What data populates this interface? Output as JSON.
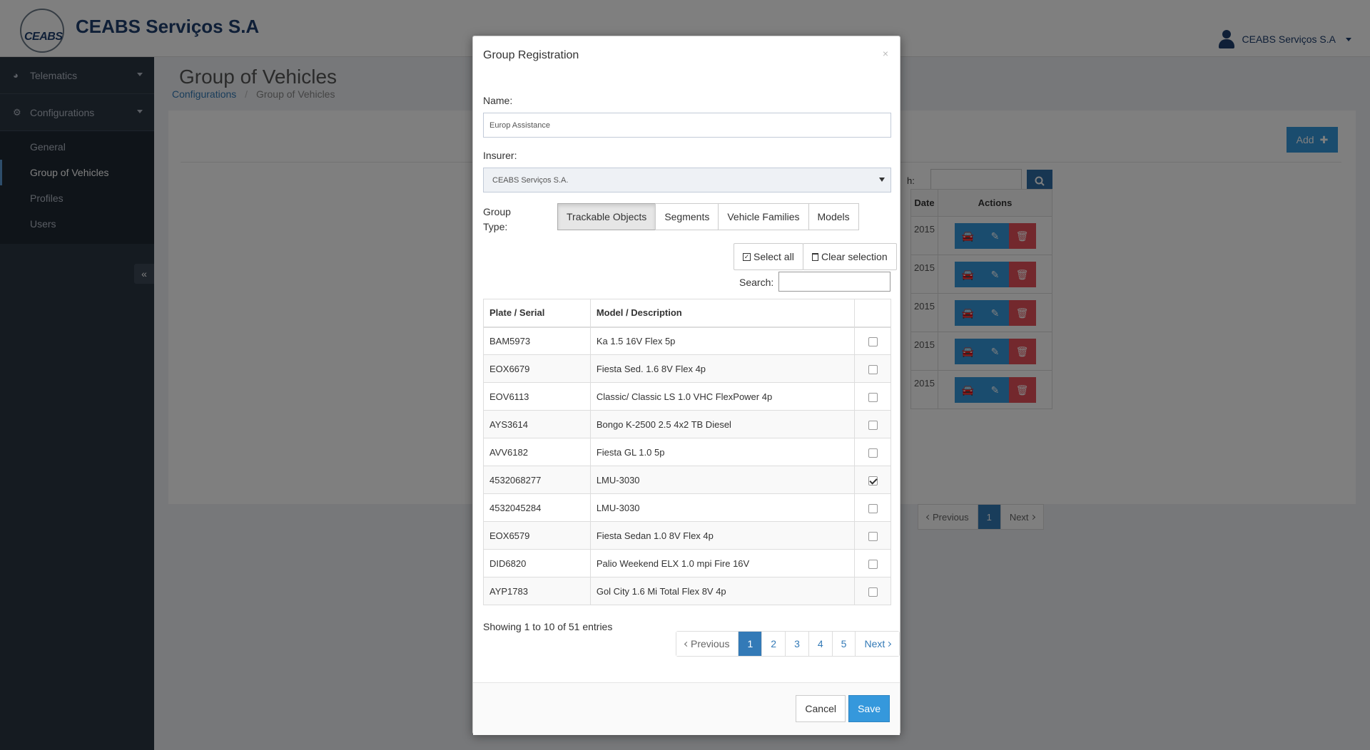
{
  "app": {
    "brand": "CEABS Serviços S.A",
    "logo_text": "CEABS",
    "user": "CEABS Serviços S.A"
  },
  "sidebar": {
    "groups": [
      {
        "label": "Telematics",
        "icon": "dashboard-icon"
      },
      {
        "label": "Configurations",
        "icon": "gears-icon"
      }
    ],
    "sub_items": [
      {
        "label": "General"
      },
      {
        "label": "Group of Vehicles"
      },
      {
        "label": "Profiles"
      },
      {
        "label": "Users"
      }
    ],
    "collapse_glyph": "«"
  },
  "page": {
    "title": "Group of Vehicles",
    "breadcrumb_root": "Configurations",
    "breadcrumb_sep": "/",
    "breadcrumb_current": "Group of Vehicles",
    "add_label": "Add",
    "search_label_partial": "h:",
    "table_headers": {
      "date": "Date",
      "actions": "Actions"
    },
    "rows_date_partial": [
      "2015",
      "2015",
      "2015",
      "2015",
      "2015"
    ],
    "pager": {
      "prev": "Previous",
      "current": "1",
      "next": "Next"
    }
  },
  "modal": {
    "title": "Group Registration",
    "close": "×",
    "name_label": "Name:",
    "name_value": "Europ Assistance",
    "insurer_label": "Insurer:",
    "insurer_value": "CEABS Serviços S.A.",
    "group_type_label": "Group Type:",
    "group_types": [
      {
        "label": "Trackable Objects"
      },
      {
        "label": "Segments"
      },
      {
        "label": "Vehicle Families"
      },
      {
        "label": "Models"
      }
    ],
    "select_all_label": "Select all",
    "clear_selection_label": "Clear selection",
    "search_label": "Search:",
    "search_value": "",
    "table": {
      "headers": [
        "Plate / Serial",
        "Model / Description",
        ""
      ],
      "rows": [
        {
          "plate": "BAM5973",
          "model": "Ka 1.5 16V Flex 5p",
          "checked": false
        },
        {
          "plate": "EOX6679",
          "model": "Fiesta Sed. 1.6 8V Flex 4p",
          "checked": false
        },
        {
          "plate": "EOV6113",
          "model": "Classic/ Classic LS 1.0 VHC FlexPower 4p",
          "checked": false
        },
        {
          "plate": "AYS3614",
          "model": "Bongo K-2500 2.5 4x2 TB Diesel",
          "checked": false
        },
        {
          "plate": "AVV6182",
          "model": "Fiesta GL 1.0 5p",
          "checked": false
        },
        {
          "plate": "4532068277",
          "model": "LMU-3030",
          "checked": true
        },
        {
          "plate": "4532045284",
          "model": "LMU-3030",
          "checked": false
        },
        {
          "plate": "EOX6579",
          "model": "Fiesta Sedan 1.0 8V Flex 4p",
          "checked": false
        },
        {
          "plate": "DID6820",
          "model": "Palio Weekend ELX 1.0 mpi Fire 16V",
          "checked": false
        },
        {
          "plate": "AYP1783",
          "model": "Gol City 1.6 Mi Total Flex 8V 4p",
          "checked": false
        }
      ]
    },
    "info": "Showing 1 to 10 of 51 entries",
    "pager": {
      "prev": "Previous",
      "pages": [
        "1",
        "2",
        "3",
        "4",
        "5"
      ],
      "current": "1",
      "next": "Next"
    },
    "cancel_label": "Cancel",
    "save_label": "Save"
  },
  "colors": {
    "primary": "#3598dc",
    "danger": "#e7505a",
    "sidebar": "#2b3643",
    "brand_text": "#1f3f6e"
  }
}
